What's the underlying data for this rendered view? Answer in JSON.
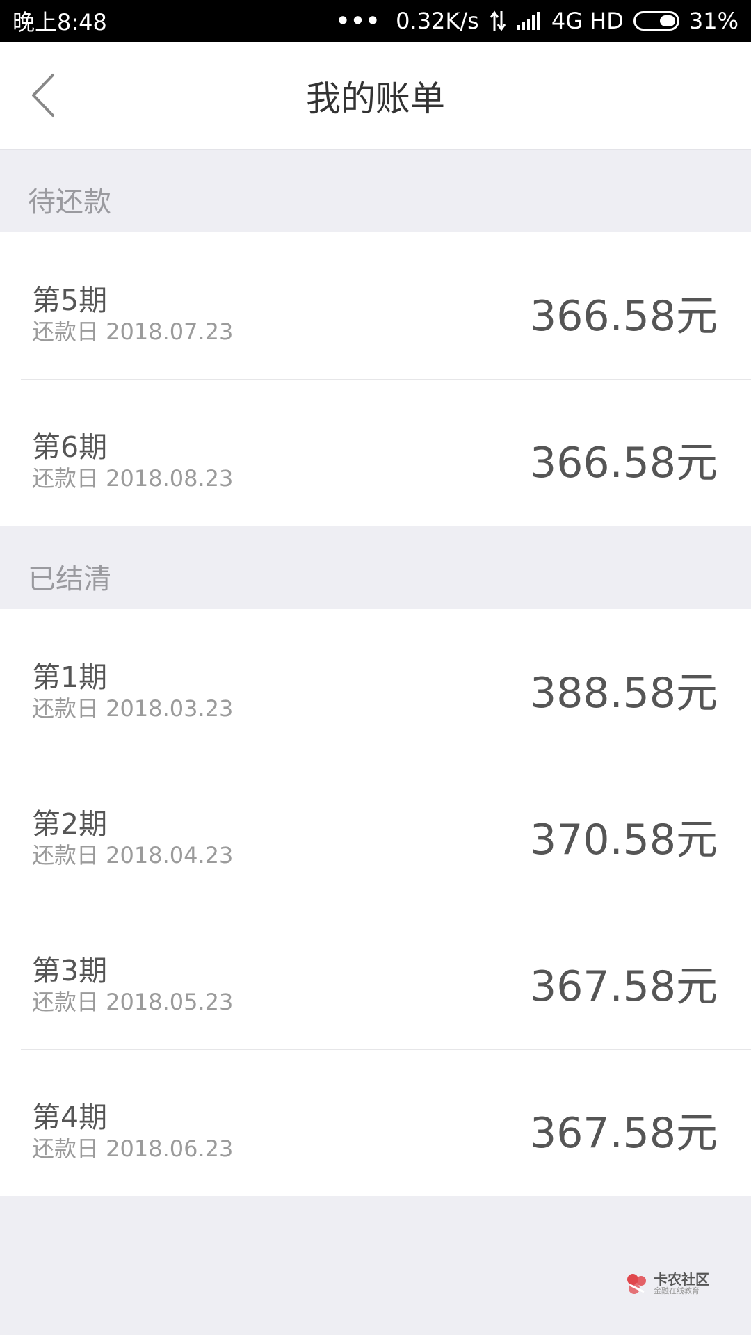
{
  "status_bar": {
    "time": "晚上8:48",
    "dots": "•••",
    "speed": "0.32K/s",
    "network": "4G HD",
    "battery": "31%"
  },
  "header": {
    "title": "我的账单",
    "back_icon": "chevron-left-icon"
  },
  "sections": {
    "pending": {
      "label": "待还款",
      "items": [
        {
          "period": "第5期",
          "date": "还款日 2018.07.23",
          "amount": "366.58元"
        },
        {
          "period": "第6期",
          "date": "还款日 2018.08.23",
          "amount": "366.58元"
        }
      ]
    },
    "settled": {
      "label": "已结清",
      "items": [
        {
          "period": "第1期",
          "date": "还款日 2018.03.23",
          "amount": "388.58元"
        },
        {
          "period": "第2期",
          "date": "还款日 2018.04.23",
          "amount": "370.58元"
        },
        {
          "period": "第3期",
          "date": "还款日 2018.05.23",
          "amount": "367.58元"
        },
        {
          "period": "第4期",
          "date": "还款日 2018.06.23",
          "amount": "367.58元"
        }
      ]
    }
  },
  "watermark": {
    "name": "卡农社区",
    "tagline": "金融在线教育"
  },
  "colors": {
    "background": "#eeeef3",
    "status_bar": "#000000",
    "card": "#ffffff",
    "logo_red": "#e0474c"
  }
}
